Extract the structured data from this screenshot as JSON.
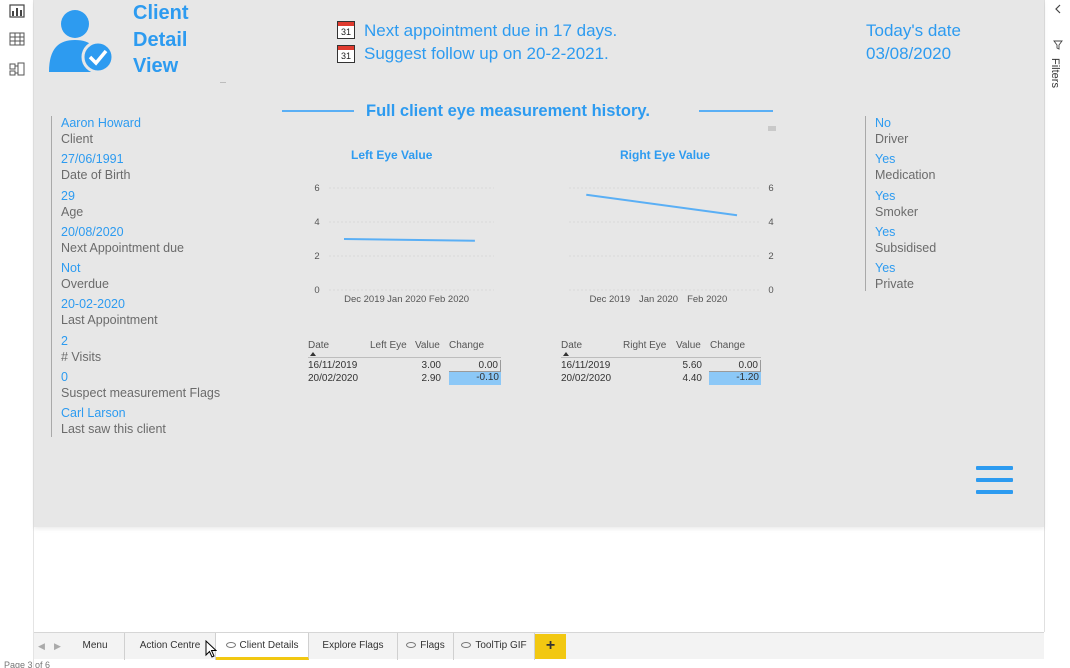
{
  "header": {
    "title_line1": "Client",
    "title_line2": "Detail",
    "title_line3": "View",
    "calendar_number": "31",
    "appointment_line": "Next appointment due in 17 days.",
    "followup_line": "Suggest follow up on 20-2-2021.",
    "today_label": "Today's date",
    "today_value": "03/08/2020"
  },
  "client_info": [
    {
      "value": "Aaron Howard",
      "label": "Client"
    },
    {
      "value": "27/06/1991",
      "label": "Date of Birth"
    },
    {
      "value": "29",
      "label": "Age"
    },
    {
      "value": "20/08/2020",
      "label": "Next Appointment due"
    },
    {
      "value": "Not",
      "label": "Overdue"
    },
    {
      "value": "20-02-2020",
      "label": "Last Appointment"
    },
    {
      "value": "2",
      "label": "# Visits"
    },
    {
      "value": "0",
      "label": "Suspect measurement Flags"
    },
    {
      "value": "Carl Larson",
      "label": "Last saw this client"
    }
  ],
  "client_flags": [
    {
      "value": "No",
      "label": "Driver"
    },
    {
      "value": "Yes",
      "label": "Medication"
    },
    {
      "value": "Yes",
      "label": "Smoker"
    },
    {
      "value": "Yes",
      "label": "Subsidised"
    },
    {
      "value": "Yes",
      "label": "Private"
    }
  ],
  "history_title": "Full client eye measurement history.",
  "chart_data": [
    {
      "type": "line",
      "title": "Left Eye Value",
      "x_ticks": [
        "Dec 2019",
        "Jan 2020",
        "Feb 2020"
      ],
      "y_ticks": [
        "0",
        "2",
        "4",
        "6"
      ],
      "ylim": [
        0,
        6
      ],
      "x": [
        "2019-11-16",
        "2020-02-20"
      ],
      "series": [
        {
          "values": [
            3.0,
            2.9
          ]
        }
      ],
      "y_axis_side": "left",
      "color": "#5aaff5"
    },
    {
      "type": "line",
      "title": "Right Eye Value",
      "x_ticks": [
        "Dec 2019",
        "Jan 2020",
        "Feb 2020"
      ],
      "y_ticks": [
        "0",
        "2",
        "4",
        "6"
      ],
      "ylim": [
        0,
        6
      ],
      "x": [
        "2019-11-16",
        "2020-02-20"
      ],
      "series": [
        {
          "values": [
            5.6,
            4.4
          ]
        }
      ],
      "y_axis_side": "right",
      "color": "#5aaff5"
    }
  ],
  "left_table": {
    "headers": [
      "Date",
      "Left Eye",
      "Value",
      "Change"
    ],
    "rows": [
      {
        "date": "16/11/2019",
        "value": "3.00",
        "change": "0.00",
        "highlight": false
      },
      {
        "date": "20/02/2020",
        "value": "2.90",
        "change": "-0.10",
        "highlight": true
      }
    ]
  },
  "right_table": {
    "headers": [
      "Date",
      "Right Eye",
      "Value",
      "Change"
    ],
    "rows": [
      {
        "date": "16/11/2019",
        "value": "5.60",
        "change": "0.00",
        "highlight": false
      },
      {
        "date": "20/02/2020",
        "value": "4.40",
        "change": "-1.20",
        "highlight": true
      }
    ]
  },
  "tabs": [
    {
      "label": "Menu",
      "hidden": false,
      "active": false
    },
    {
      "label": "Action Centre",
      "hidden": false,
      "active": false
    },
    {
      "label": "Client Details",
      "hidden": true,
      "active": true
    },
    {
      "label": "Explore Flags",
      "hidden": false,
      "active": false
    },
    {
      "label": "Flags",
      "hidden": true,
      "active": false
    },
    {
      "label": "ToolTip GIF",
      "hidden": true,
      "active": false
    }
  ],
  "add_tab_label": "+",
  "filters_label": "Filters",
  "page_status": "Page 3 of 6",
  "colors": {
    "accent": "#2d9bf0",
    "tab_active": "#f2c811",
    "highlight_cell": "#8cc8f7"
  }
}
